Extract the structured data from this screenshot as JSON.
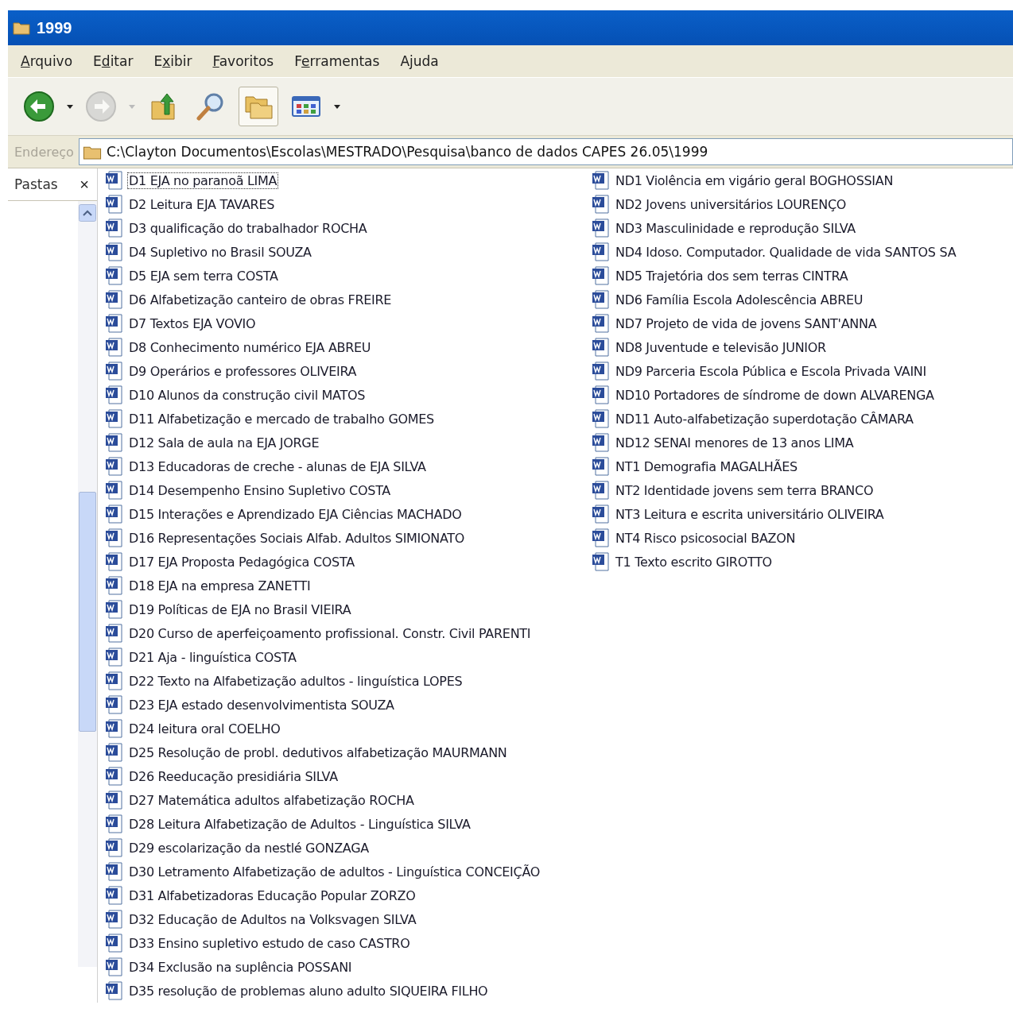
{
  "window": {
    "title": "1999"
  },
  "menu": [
    {
      "accel": "A",
      "after": "rquivo"
    },
    {
      "before": "E",
      "accel": "d",
      "after": "itar"
    },
    {
      "before": "E",
      "accel": "x",
      "after": "ibir"
    },
    {
      "accel": "F",
      "after": "avoritos"
    },
    {
      "before": "F",
      "accel": "e",
      "after": "rramentas"
    },
    {
      "before": "A",
      "accel": "j",
      "after": "uda"
    }
  ],
  "toolbar": [
    {
      "kind": "back",
      "disabled": false,
      "pressed": false
    },
    {
      "kind": "forward",
      "disabled": true,
      "pressed": false
    },
    {
      "kind": "up",
      "disabled": false,
      "pressed": false
    },
    {
      "kind": "search",
      "disabled": false,
      "pressed": false
    },
    {
      "kind": "folders",
      "disabled": false,
      "pressed": true
    },
    {
      "kind": "views",
      "disabled": false,
      "pressed": false
    }
  ],
  "address": {
    "label": "Endereço",
    "path": "C:\\Clayton Documentos\\Escolas\\MESTRADO\\Pesquisa\\banco de dados CAPES 26.05\\1999"
  },
  "folders_pane": {
    "title": "Pastas",
    "close": "×"
  },
  "files": [
    [
      {
        "name": "D1 EJA no paranoã LIMA",
        "selected": true
      },
      {
        "name": "D2 Leitura EJA TAVARES",
        "selected": false
      },
      {
        "name": "D3 qualificação do trabalhador ROCHA",
        "selected": false
      },
      {
        "name": "D4 Supletivo no Brasil SOUZA",
        "selected": false
      },
      {
        "name": "D5 EJA sem terra COSTA",
        "selected": false
      },
      {
        "name": "D6 Alfabetização canteiro de obras FREIRE",
        "selected": false
      },
      {
        "name": "D7 Textos EJA VOVIO",
        "selected": false
      },
      {
        "name": "D8 Conhecimento numérico EJA ABREU",
        "selected": false
      },
      {
        "name": "D9 Operários e professores OLIVEIRA",
        "selected": false
      },
      {
        "name": "D10 Alunos da construção civil MATOS",
        "selected": false
      },
      {
        "name": "D11 Alfabetização e mercado de trabalho GOMES",
        "selected": false
      },
      {
        "name": "D12 Sala de aula na EJA JORGE",
        "selected": false
      },
      {
        "name": "D13 Educadoras de creche - alunas de EJA SILVA",
        "selected": false
      },
      {
        "name": "D14 Desempenho Ensino Supletivo COSTA",
        "selected": false
      },
      {
        "name": "D15 Interações e Aprendizado EJA Ciências MACHADO",
        "selected": false
      },
      {
        "name": "D16 Representações Sociais Alfab. Adultos SIMIONATO",
        "selected": false
      },
      {
        "name": "D17 EJA Proposta Pedagógica COSTA",
        "selected": false
      },
      {
        "name": "D18 EJA na empresa ZANETTI",
        "selected": false
      },
      {
        "name": "D19 Políticas de EJA no Brasil VIEIRA",
        "selected": false
      },
      {
        "name": "D20 Curso de aperfeiçoamento profissional. Constr. Civil PARENTI",
        "selected": false
      },
      {
        "name": "D21 Aja - linguística COSTA",
        "selected": false
      },
      {
        "name": "D22 Texto na Alfabetização adultos - linguística LOPES",
        "selected": false
      },
      {
        "name": "D23 EJA estado desenvolvimentista SOUZA",
        "selected": false
      },
      {
        "name": "D24 leitura oral COELHO",
        "selected": false
      },
      {
        "name": "D25 Resolução de probl. dedutivos alfabetização MAURMANN",
        "selected": false
      },
      {
        "name": "D26 Reeducação presidiária SILVA",
        "selected": false
      },
      {
        "name": "D27 Matemática adultos alfabetização ROCHA",
        "selected": false
      },
      {
        "name": "D28 Leitura Alfabetização de Adultos - Linguística SILVA",
        "selected": false
      },
      {
        "name": "D29 escolarização da nestlé GONZAGA",
        "selected": false
      },
      {
        "name": "D30 Letramento Alfabetização de adultos - Linguística CONCEIÇÃO",
        "selected": false
      },
      {
        "name": "D31 Alfabetizadoras Educação Popular ZORZO",
        "selected": false
      },
      {
        "name": "D32 Educação de Adultos na Volksvagen SILVA",
        "selected": false
      },
      {
        "name": "D33 Ensino supletivo estudo de caso CASTRO",
        "selected": false
      },
      {
        "name": "D34 Exclusão na suplência POSSANI",
        "selected": false
      },
      {
        "name": "D35 resolução de problemas aluno adulto SIQUEIRA FILHO",
        "selected": false
      }
    ],
    [
      {
        "name": "ND1 Violência em vigário geral BOGHOSSIAN",
        "selected": false
      },
      {
        "name": "ND2 Jovens universitários LOURENÇO",
        "selected": false
      },
      {
        "name": "ND3 Masculinidade e reprodução SILVA",
        "selected": false
      },
      {
        "name": "ND4 Idoso. Computador. Qualidade de vida SANTOS SA",
        "selected": false
      },
      {
        "name": "ND5 Trajetória dos sem terras CINTRA",
        "selected": false
      },
      {
        "name": "ND6 Família Escola Adolescência ABREU",
        "selected": false
      },
      {
        "name": "ND7 Projeto de vida de jovens SANT'ANNA",
        "selected": false
      },
      {
        "name": "ND8 Juventude e televisão JUNIOR",
        "selected": false
      },
      {
        "name": "ND9 Parceria Escola Pública e Escola Privada VAINI",
        "selected": false
      },
      {
        "name": "ND10 Portadores de síndrome de down ALVARENGA",
        "selected": false
      },
      {
        "name": "ND11 Auto-alfabetização superdotação CÂMARA",
        "selected": false
      },
      {
        "name": "ND12 SENAI menores de 13 anos LIMA",
        "selected": false
      },
      {
        "name": "NT1 Demografia MAGALHÃES",
        "selected": false
      },
      {
        "name": "NT2 Identidade jovens sem terra BRANCO",
        "selected": false
      },
      {
        "name": "NT3 Leitura e escrita universitário OLIVEIRA",
        "selected": false
      },
      {
        "name": "NT4 Risco psicosocial BAZON",
        "selected": false
      },
      {
        "name": "T1 Texto escrito GIROTTO",
        "selected": false
      }
    ]
  ]
}
